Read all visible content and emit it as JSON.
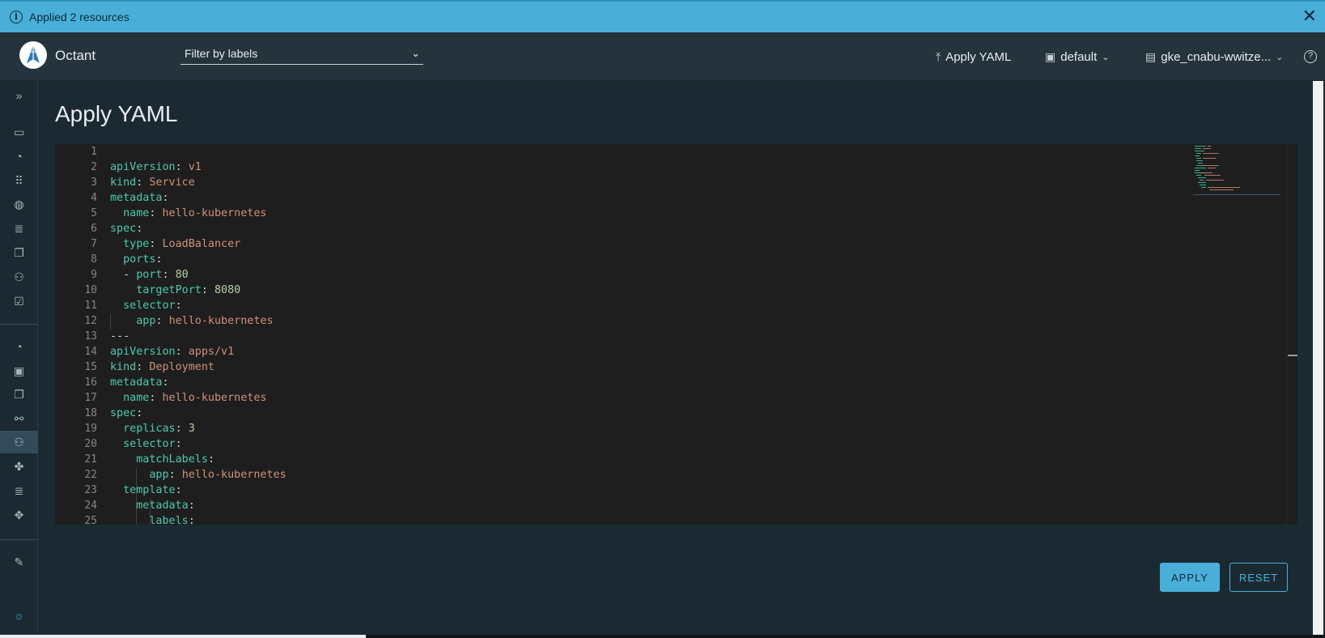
{
  "alert": {
    "message": "Applied 2 resources",
    "info_icon": "info-icon",
    "close_icon": "close-icon"
  },
  "header": {
    "app_name": "Octant",
    "filter_placeholder": "Filter by labels",
    "apply_yaml_label": "Apply YAML",
    "namespace_label": "default",
    "context_label": "gke_cnabu-wwitze..."
  },
  "page": {
    "title": "Apply YAML"
  },
  "editor": {
    "lines": [
      {
        "n": "1"
      },
      {
        "n": "2"
      },
      {
        "n": "3"
      },
      {
        "n": "4"
      },
      {
        "n": "5"
      },
      {
        "n": "6"
      },
      {
        "n": "7"
      },
      {
        "n": "8"
      },
      {
        "n": "9"
      },
      {
        "n": "10"
      },
      {
        "n": "11"
      },
      {
        "n": "12"
      },
      {
        "n": "13"
      },
      {
        "n": "14"
      },
      {
        "n": "15"
      },
      {
        "n": "16"
      },
      {
        "n": "17"
      },
      {
        "n": "18"
      },
      {
        "n": "19"
      },
      {
        "n": "20"
      },
      {
        "n": "21"
      },
      {
        "n": "22"
      },
      {
        "n": "23"
      },
      {
        "n": "24"
      },
      {
        "n": "25"
      }
    ],
    "code": {
      "l2_key": "apiVersion",
      "l2_val": "v1",
      "l3_key": "kind",
      "l3_val": "Service",
      "l4_key": "metadata",
      "l5_key": "name",
      "l5_val": "hello-kubernetes",
      "l6_key": "spec",
      "l7_key": "type",
      "l7_val": "LoadBalancer",
      "l8_key": "ports",
      "l9_key": "port",
      "l9_val": "80",
      "l10_key": "targetPort",
      "l10_val": "8080",
      "l11_key": "selector",
      "l12_key": "app",
      "l12_val": "hello-kubernetes",
      "l13_text": "---",
      "l14_key": "apiVersion",
      "l14_val": "apps/v1",
      "l15_key": "kind",
      "l15_val": "Deployment",
      "l16_key": "metadata",
      "l17_key": "name",
      "l17_val": "hello-kubernetes",
      "l18_key": "spec",
      "l19_key": "replicas",
      "l19_val": "3",
      "l20_key": "selector",
      "l21_key": "matchLabels",
      "l22_key": "app",
      "l22_val": "hello-kubernetes",
      "l23_key": "template",
      "l24_key": "metadata",
      "l25_key": "labels"
    }
  },
  "actions": {
    "apply": "APPLY",
    "reset": "RESET"
  },
  "colors": {
    "accent": "#49afd9",
    "background": "#1b2a32",
    "header": "#25333d",
    "editor_bg": "#1e1e1e"
  }
}
